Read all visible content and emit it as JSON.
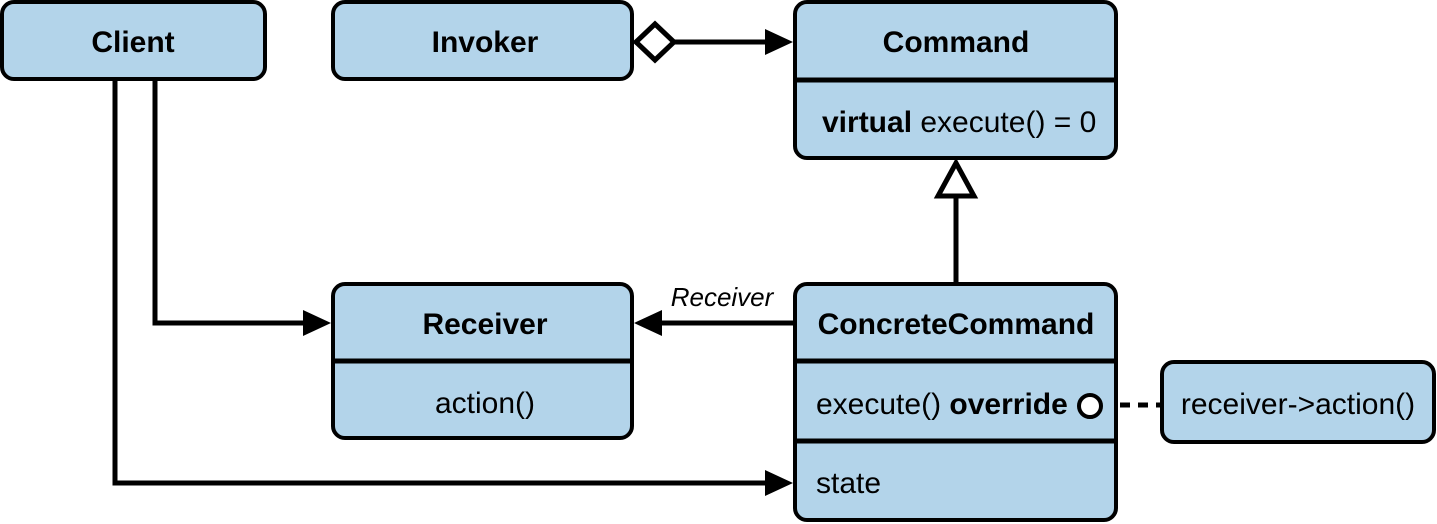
{
  "colors": {
    "box_fill": "#b3d4ea",
    "stroke": "#000000"
  },
  "classes": {
    "client": {
      "name": "Client"
    },
    "invoker": {
      "name": "Invoker"
    },
    "command": {
      "name": "Command",
      "method_keyword": "virtual",
      "method": "execute() = 0"
    },
    "receiver": {
      "name": "Receiver",
      "method": "action()"
    },
    "concrete_command": {
      "name": "ConcreteCommand",
      "method": "execute()",
      "method_keyword": "override",
      "field": "state"
    }
  },
  "note": {
    "text": "receiver->action()"
  },
  "associations": {
    "receiver_label": "Receiver"
  }
}
